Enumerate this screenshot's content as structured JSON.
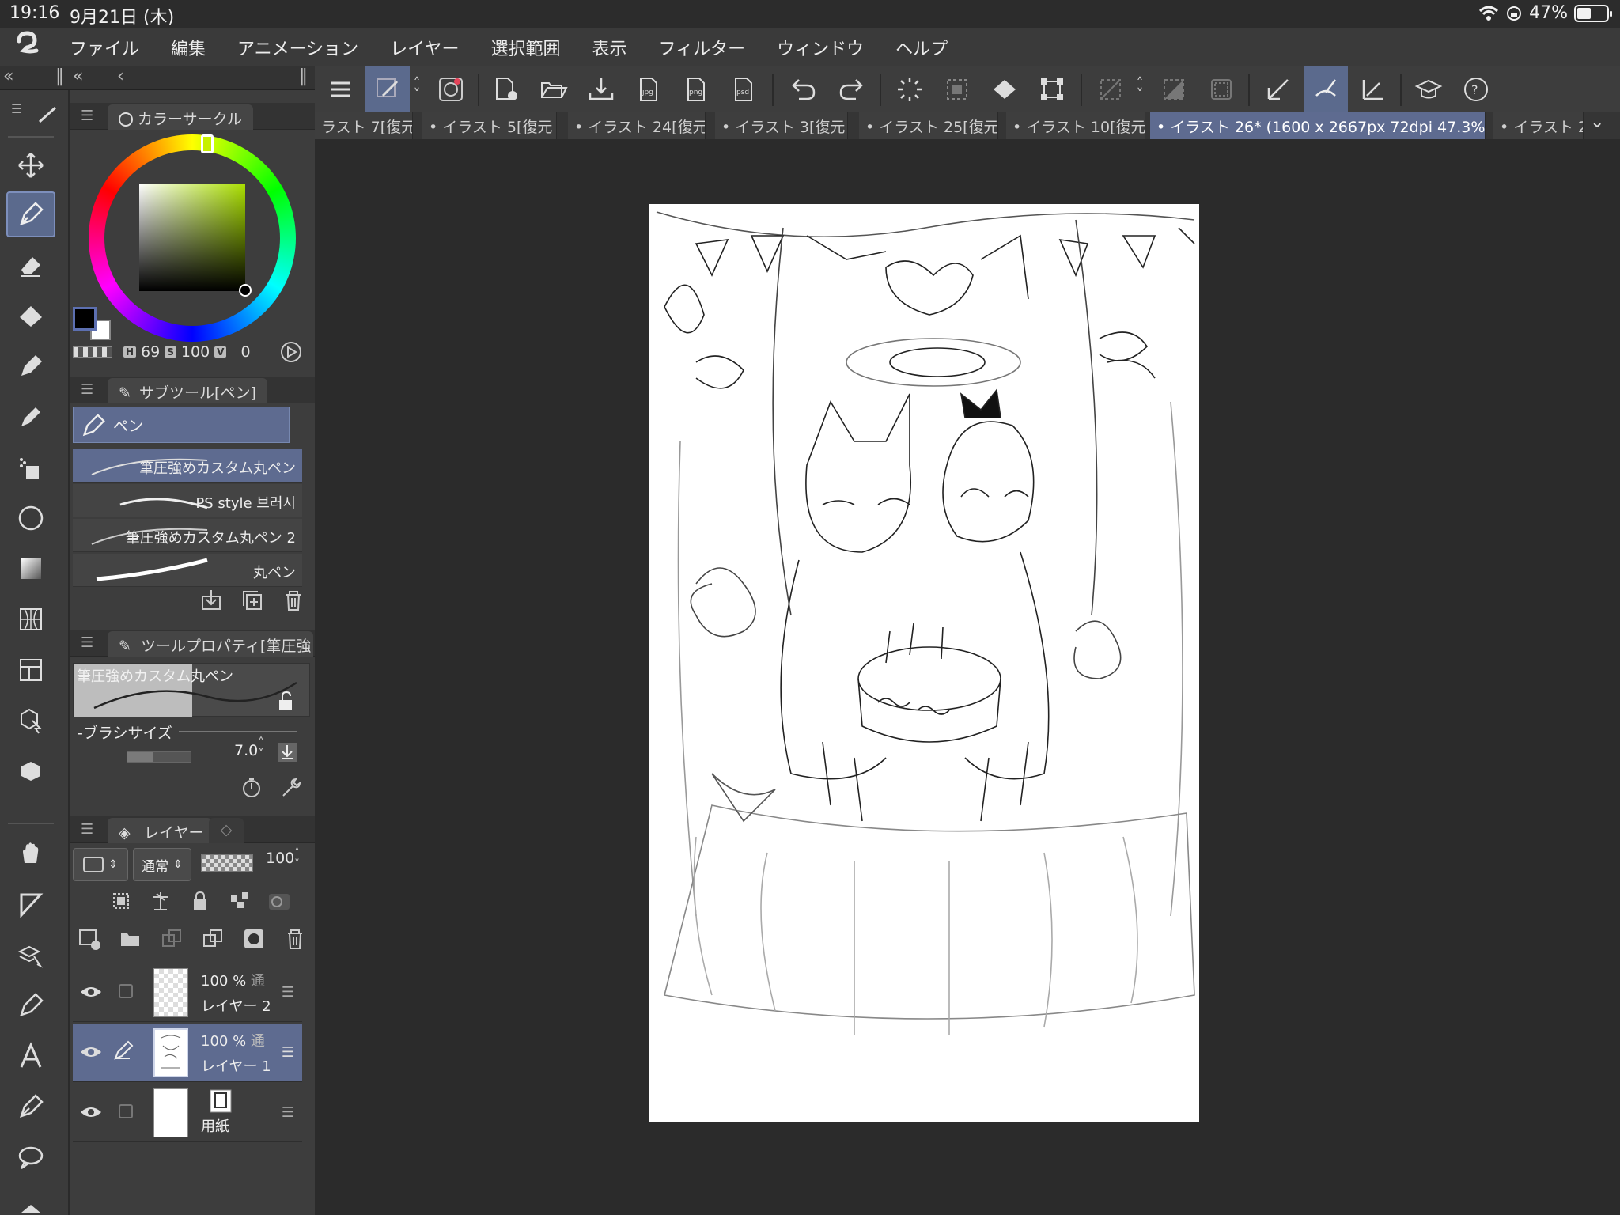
{
  "status": {
    "time": "19:16",
    "date": "9月21日 (木)",
    "battery": "47%",
    "battery_level": 0.47
  },
  "menu": [
    "ファイル",
    "編集",
    "アニメーション",
    "レイヤー",
    "選択範囲",
    "表示",
    "フィルター",
    "ウィンドウ",
    "ヘルプ"
  ],
  "color_palette": {
    "title": "カラーサークル",
    "h_label": "H",
    "h_value": "69",
    "s_label": "S",
    "s_value": "100",
    "v_label": "V",
    "v_value": "0",
    "main_color": "#000000",
    "sub_color": "#ffffff"
  },
  "subtool": {
    "title": "サブツール[ペン]",
    "category": "ペン",
    "brushes": [
      "筆圧強めカスタム丸ペン",
      "PS style 브러시",
      "筆圧強めカスタム丸ペン 2",
      "丸ペン"
    ]
  },
  "tool_property": {
    "title": "ツールプロパティ[筆圧強",
    "preset_name": "筆圧強めカスタム丸ペン",
    "brush_size_label": "ブラシサイズ",
    "brush_size_value": "7.0"
  },
  "layer_palette": {
    "title": "レイヤー",
    "blend_mode": "通常",
    "opacity": "100",
    "layers": [
      {
        "opacity": "100 %",
        "mode": "通",
        "name": "レイヤー 2"
      },
      {
        "opacity": "100 %",
        "mode": "通",
        "name": "レイヤー 1"
      },
      {
        "opacity": "",
        "mode": "",
        "name": "用紙"
      }
    ]
  },
  "tabs": [
    "ラスト 7[復元",
    "• イラスト 5[復元",
    "• イラスト 24[復元",
    "• イラスト 3[復元",
    "• イラスト 25[復元",
    "• イラスト 10[復元",
    "• イラスト 26* (1600 x 2667px 72dpi 47.3%)",
    "• イラスト 2"
  ],
  "accent_color": "#5e6b90"
}
